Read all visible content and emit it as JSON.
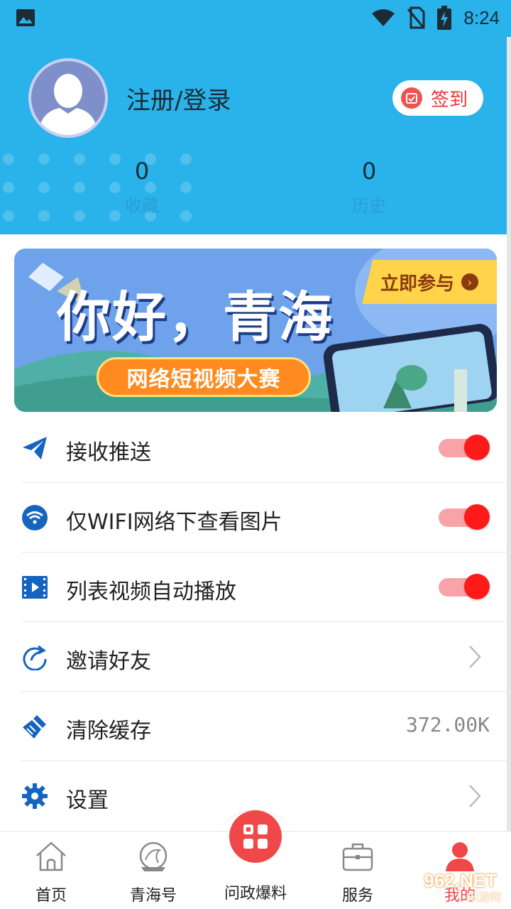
{
  "status_bar": {
    "time": "8:24"
  },
  "profile": {
    "login_text": "注册/登录",
    "checkin_label": "签到",
    "stats": [
      {
        "value": "0",
        "label": "收藏"
      },
      {
        "value": "0",
        "label": "历史"
      }
    ]
  },
  "banner": {
    "title": "你好，青海",
    "join_label": "立即参与",
    "subtitle": "网络短视频大赛"
  },
  "menu": {
    "items": [
      {
        "label": "接收推送",
        "control": "toggle",
        "on": true
      },
      {
        "label": "仅WIFI网络下查看图片",
        "control": "toggle",
        "on": true
      },
      {
        "label": "列表视频自动播放",
        "control": "toggle",
        "on": true
      },
      {
        "label": "邀请好友",
        "control": "chevron"
      },
      {
        "label": "清除缓存",
        "control": "value",
        "value": "372.00K"
      },
      {
        "label": "设置",
        "control": "chevron"
      }
    ]
  },
  "bottom_nav": {
    "items": [
      {
        "label": "首页",
        "icon": "home-icon"
      },
      {
        "label": "青海号",
        "icon": "qinghai-hao-icon"
      },
      {
        "label": "问政爆料",
        "icon": "grid-icon"
      },
      {
        "label": "服务",
        "icon": "briefcase-icon"
      },
      {
        "label": "我的",
        "icon": "user-icon",
        "active": true
      }
    ]
  },
  "watermark": {
    "brand": "962.NET",
    "sub": "乐游网"
  },
  "colors": {
    "header_bg": "#29b3ea",
    "accent_red": "#ff1a1a",
    "icon_blue": "#1565c0"
  }
}
